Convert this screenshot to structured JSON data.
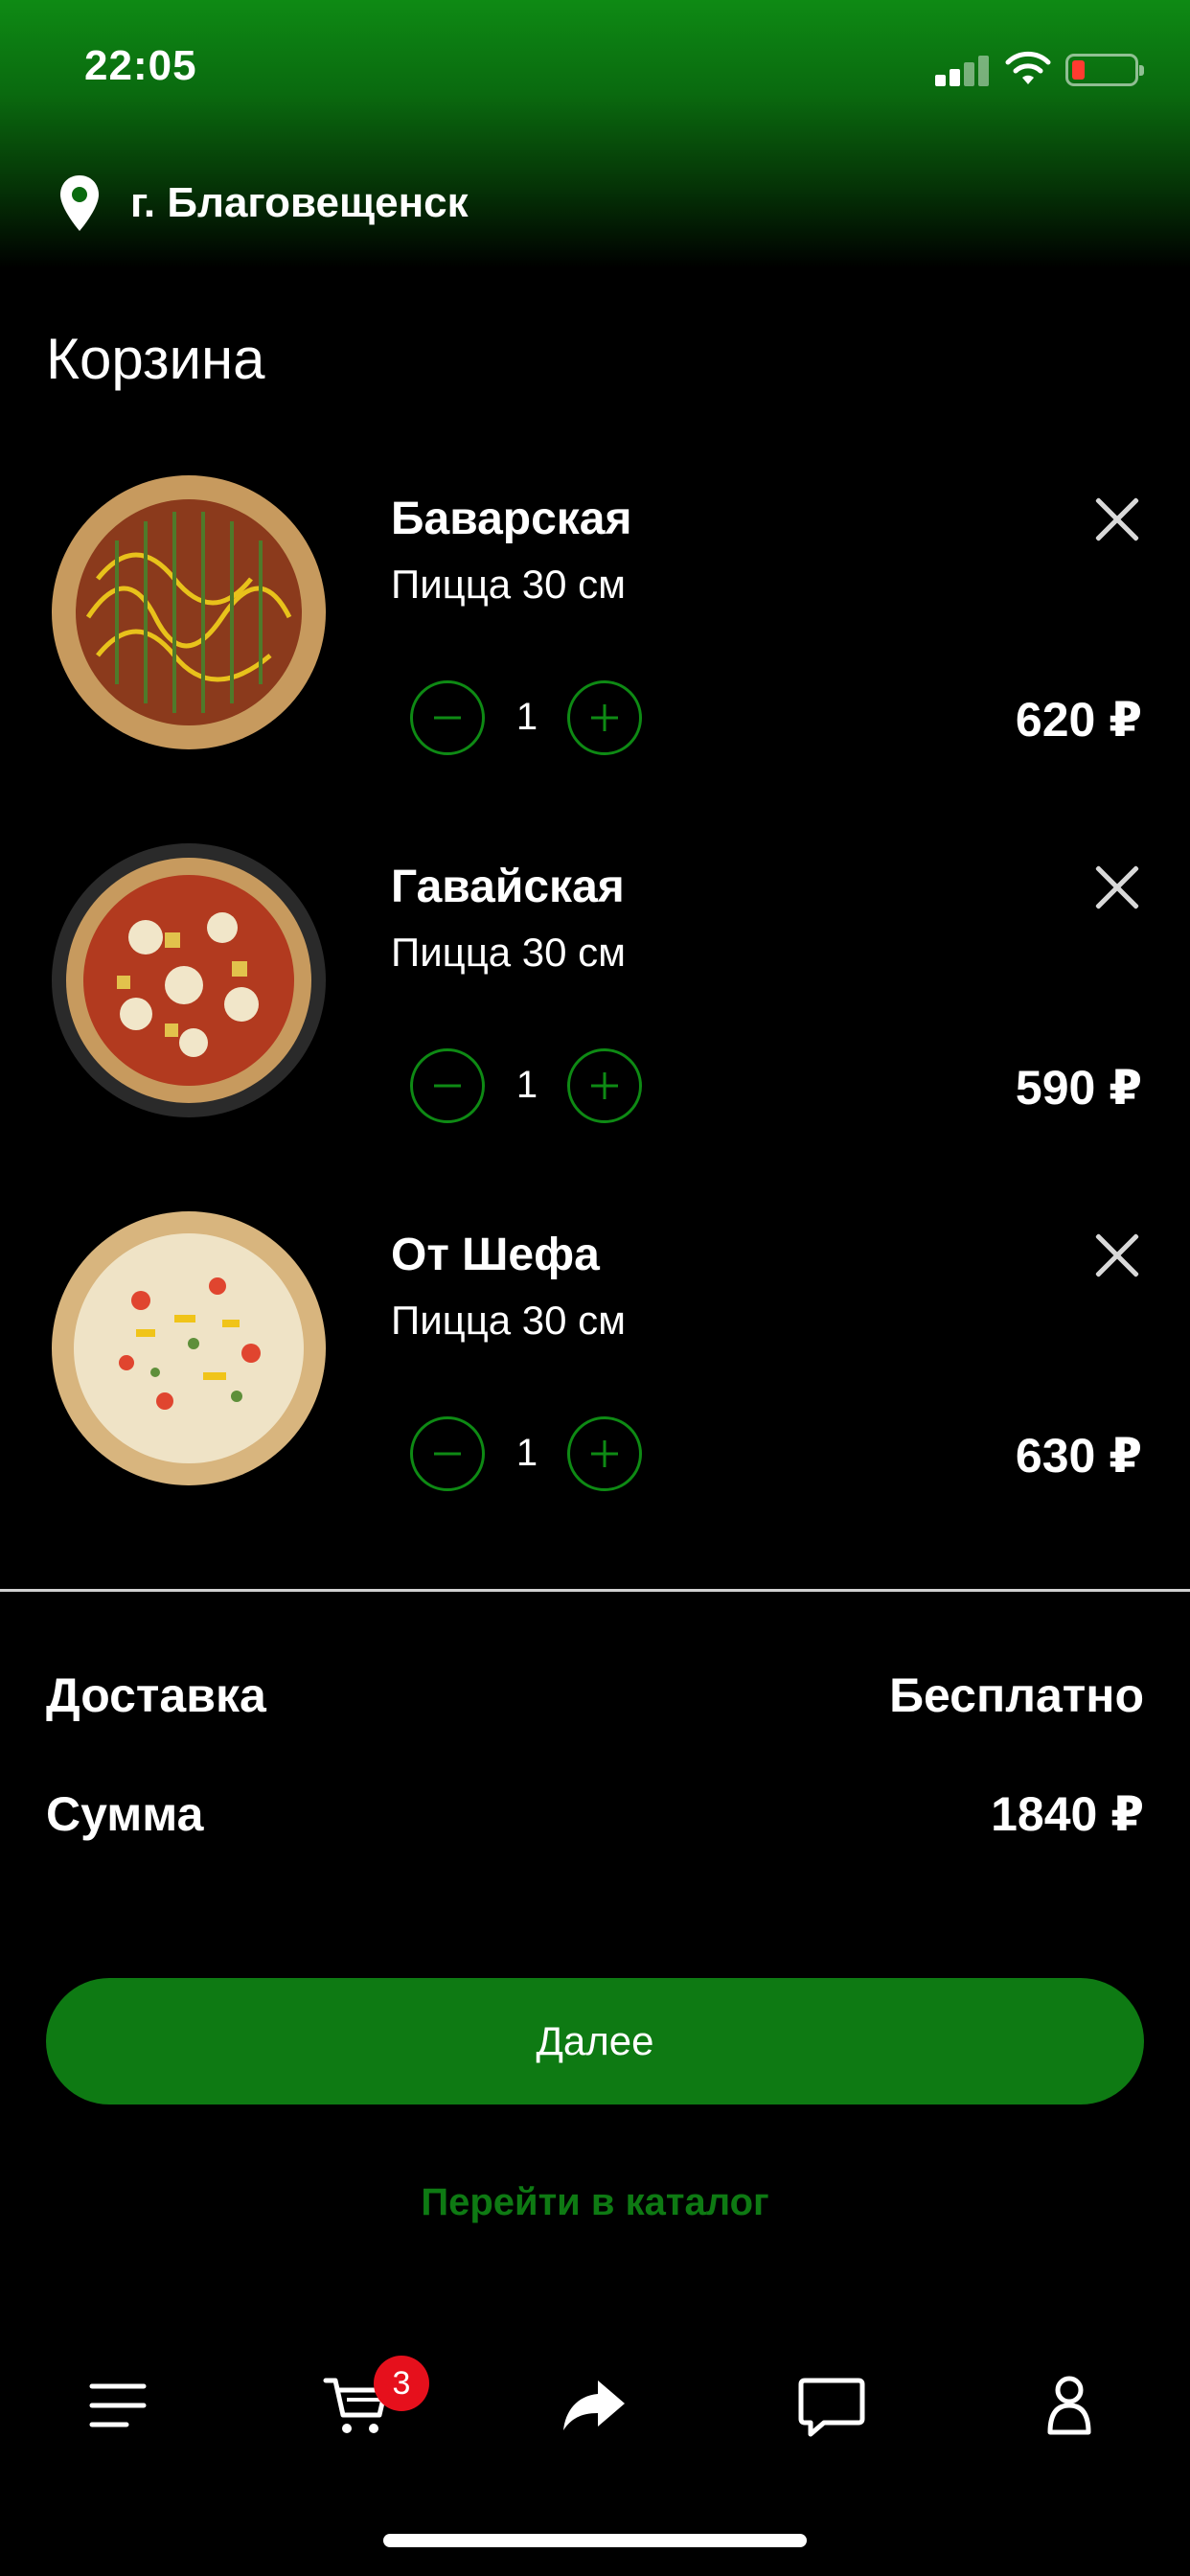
{
  "status_bar": {
    "time": "22:05"
  },
  "location": {
    "city": "г. Благовещенск",
    "icon": "location-pin-icon"
  },
  "page": {
    "title": "Корзина"
  },
  "cart": {
    "items": [
      {
        "name": "Баварская",
        "description": "Пицца 30 см",
        "quantity": "1",
        "price": "620 ₽"
      },
      {
        "name": "Гавайская",
        "description": "Пицца 30 см",
        "quantity": "1",
        "price": "590 ₽"
      },
      {
        "name": "От Шефа",
        "description": "Пицца 30 см",
        "quantity": "1",
        "price": "630 ₽"
      }
    ]
  },
  "summary": {
    "delivery_label": "Доставка",
    "delivery_value": "Бесплатно",
    "total_label": "Сумма",
    "total_value": "1840 ₽"
  },
  "actions": {
    "next_label": "Далее",
    "catalog_link": "Перейти в каталог"
  },
  "tabbar": {
    "cart_badge": "3",
    "items": [
      "menu-icon",
      "cart-icon",
      "share-icon",
      "chat-icon",
      "profile-icon"
    ]
  },
  "colors": {
    "accent": "#0e7a13",
    "badge": "#e6101c",
    "background": "#000000"
  }
}
